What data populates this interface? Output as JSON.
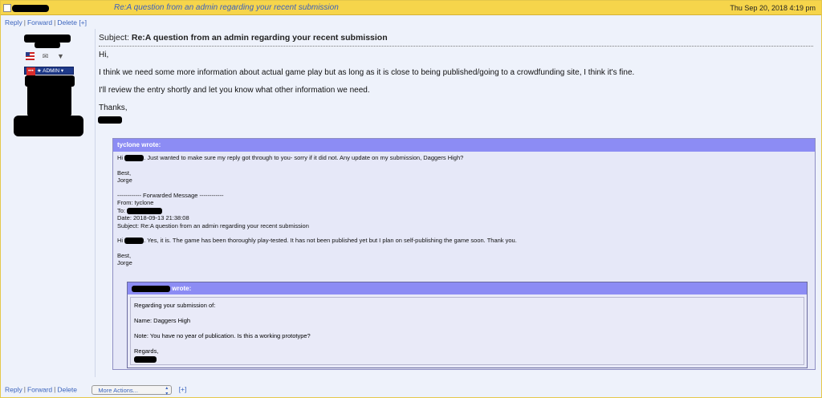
{
  "header": {
    "subject": "Re:A question from an admin regarding your recent submission",
    "date": "Thu Sep 20, 2018 4:19 pm"
  },
  "actions": {
    "reply": "Reply",
    "forward": "Forward",
    "delete": "Delete",
    "expand": "[+]",
    "more_actions": "More Actions..."
  },
  "sidebar": {
    "badge_prefix": "•••",
    "badge_label": "★ ADMIN ▾"
  },
  "message": {
    "subject_label": "Subject:",
    "subject": "Re:A question from an admin regarding your recent submission",
    "greeting": "Hi,",
    "paragraph1": "I think we need some more information about actual game play but as long as it is close to being published/going to a crowdfunding site, I think it's fine.",
    "paragraph2": "I'll review the entry shortly and let you know what other information we need.",
    "closing": "Thanks,"
  },
  "quote": {
    "header": "tyclone wrote:",
    "hi": "Hi",
    "line1": ". Just wanted to make sure my reply got through to you- sorry if it did not. Any update on my submission, Daggers High?",
    "best": "Best,",
    "name": "Jorge",
    "forwarded": "------------ Forwarded Message ------------",
    "from": "From: tyclone",
    "to": "To:",
    "date": "Date: 2018-09-13 21:38:08",
    "subject": "Subject: Re:A question from an admin regarding your recent submission",
    "hi2": "Hi",
    "line2": ". Yes, it is. The game has been thoroughly play-tested. It has not been published yet but I plan on self-publishing the game soon. Thank you.",
    "best2": "Best,",
    "name2": "Jorge"
  },
  "nested": {
    "header_suffix": "wrote:",
    "line1": "Regarding your submission of:",
    "line2": "Name: Daggers High",
    "line3": "Note: You have no year of publication. Is this a working prototype?",
    "line4": "Regards,"
  }
}
